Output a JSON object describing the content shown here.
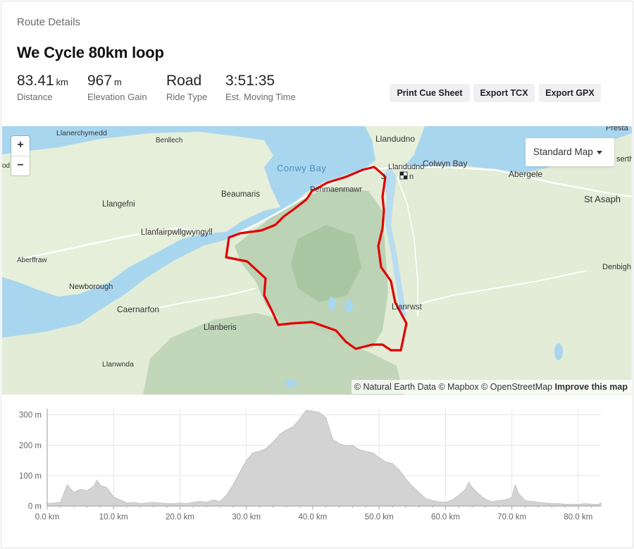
{
  "breadcrumb": "Route Details",
  "route": {
    "title": "We Cycle 80km loop"
  },
  "stats": [
    {
      "value": "83.41",
      "unit": "km",
      "label": "Distance"
    },
    {
      "value": "967",
      "unit": "m",
      "label": "Elevation Gain"
    },
    {
      "value": "Road",
      "unit": "",
      "label": "Ride Type"
    },
    {
      "value": "3:51:35",
      "unit": "",
      "label": "Est. Moving Time"
    }
  ],
  "actions": {
    "print": "Print Cue Sheet",
    "tcx": "Export TCX",
    "gpx": "Export GPX"
  },
  "map": {
    "style_label": "Standard Map",
    "zoom_in": "+",
    "zoom_out": "−",
    "attribution": "© Natural Earth Data © Mapbox © OpenStreetMap",
    "improve": "Improve this map",
    "route_color": "#e00000",
    "water_color": "#a9d6ef",
    "land_color": "#e4efd9",
    "places": {
      "llanerchymedd": "Llanerchymedd",
      "benllech": "Benllech",
      "llandudno": "Llandudno",
      "prestatyn": "Presta",
      "conwy_bay": "Conwy Bay",
      "llandudno_junction": "Llandudno",
      "junction_prefix": "J",
      "junction_suffix": "n",
      "colwyn_bay": "Colwyn Bay",
      "abergele": "Abergele",
      "rhyl": "serth",
      "rhosneigr": "od",
      "beaumaris": "Beaumaris",
      "penmaenmawr": "Penmaenmawr",
      "st_asaph": "St Asaph",
      "llangefni": "Llangefni",
      "llanfair": "Llanfairpwllgwyngyll",
      "aberffraw": "Aberffraw",
      "denbigh": "Denbigh",
      "newborough": "Newborough",
      "llanrwst": "Llanrwst",
      "caernarfon": "Caernarfon",
      "llanberis": "Llanberis",
      "llanwnda": "Llanwnda"
    }
  },
  "chart_data": {
    "type": "area",
    "title": "",
    "xlabel": "",
    "ylabel": "",
    "xlim": [
      0,
      83.41
    ],
    "ylim": [
      0,
      320
    ],
    "x_ticks": [
      "0.0 km",
      "10.0 km",
      "20.0 km",
      "30.0 km",
      "40.0 km",
      "50.0 km",
      "60.0 km",
      "70.0 km",
      "80.0 km"
    ],
    "y_ticks": [
      "0 m",
      "100 m",
      "200 m",
      "300 m"
    ],
    "grid": true,
    "x": [
      0,
      1,
      2,
      3,
      4,
      5,
      6,
      7,
      7.5,
      8,
      9,
      10,
      11,
      12,
      13,
      14,
      15,
      16,
      17,
      18,
      19,
      20,
      21,
      22,
      23,
      24,
      25,
      26,
      27,
      28,
      29,
      30,
      31,
      32,
      33,
      34,
      35,
      36,
      37,
      38,
      38.5,
      39,
      40,
      41,
      42,
      43,
      44,
      45,
      46,
      47,
      48,
      49,
      50,
      51,
      52,
      53,
      54,
      55,
      56,
      57,
      58,
      59,
      60,
      61,
      62,
      63,
      63.5,
      64,
      65,
      66,
      67,
      68,
      69,
      70,
      70.5,
      71,
      72,
      73,
      74,
      75,
      76,
      77,
      78,
      79,
      80,
      81,
      82,
      83,
      83.41
    ],
    "elevation": [
      8,
      10,
      12,
      70,
      45,
      55,
      50,
      65,
      85,
      68,
      60,
      30,
      20,
      10,
      12,
      8,
      10,
      12,
      10,
      8,
      8,
      10,
      8,
      12,
      15,
      12,
      20,
      15,
      35,
      70,
      110,
      150,
      175,
      180,
      190,
      210,
      235,
      250,
      260,
      285,
      300,
      315,
      312,
      308,
      290,
      220,
      205,
      198,
      200,
      185,
      180,
      175,
      160,
      145,
      140,
      120,
      90,
      65,
      45,
      25,
      18,
      14,
      12,
      20,
      35,
      55,
      78,
      62,
      40,
      22,
      14,
      18,
      20,
      28,
      70,
      42,
      18,
      15,
      12,
      10,
      8,
      8,
      6,
      5,
      5,
      8,
      6,
      5,
      10
    ]
  }
}
